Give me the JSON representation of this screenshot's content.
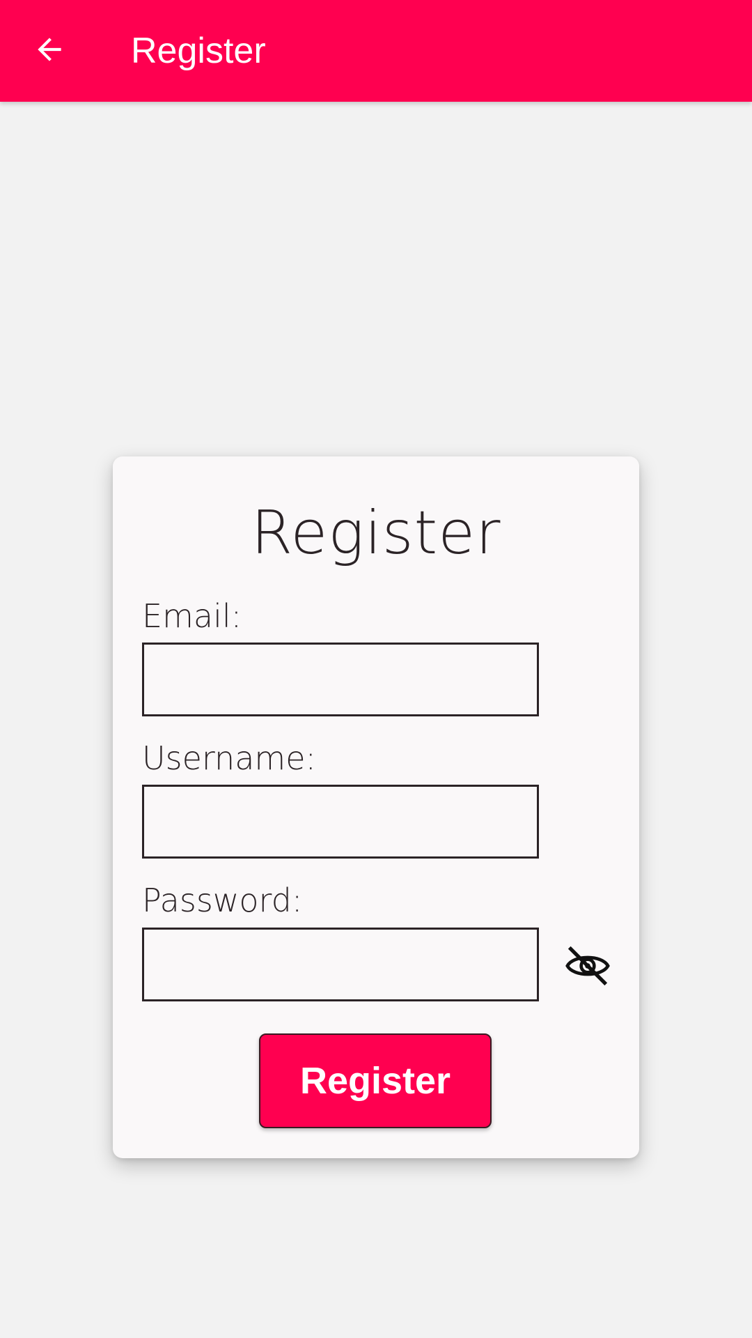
{
  "app_bar": {
    "title": "Register",
    "back_icon": "arrow-left-icon",
    "color": "#ff0050"
  },
  "form": {
    "title": "Register",
    "email": {
      "label": "Email:",
      "value": "",
      "placeholder": ""
    },
    "username": {
      "label": "Username:",
      "value": "",
      "placeholder": ""
    },
    "password": {
      "label": "Password:",
      "value": "",
      "placeholder": ""
    },
    "password_toggle_icon": "eye-off-icon",
    "submit_label": "Register"
  },
  "colors": {
    "accent": "#ff0050",
    "background": "#f2f2f2",
    "card": "#faf8f9",
    "text": "#2b2326"
  }
}
